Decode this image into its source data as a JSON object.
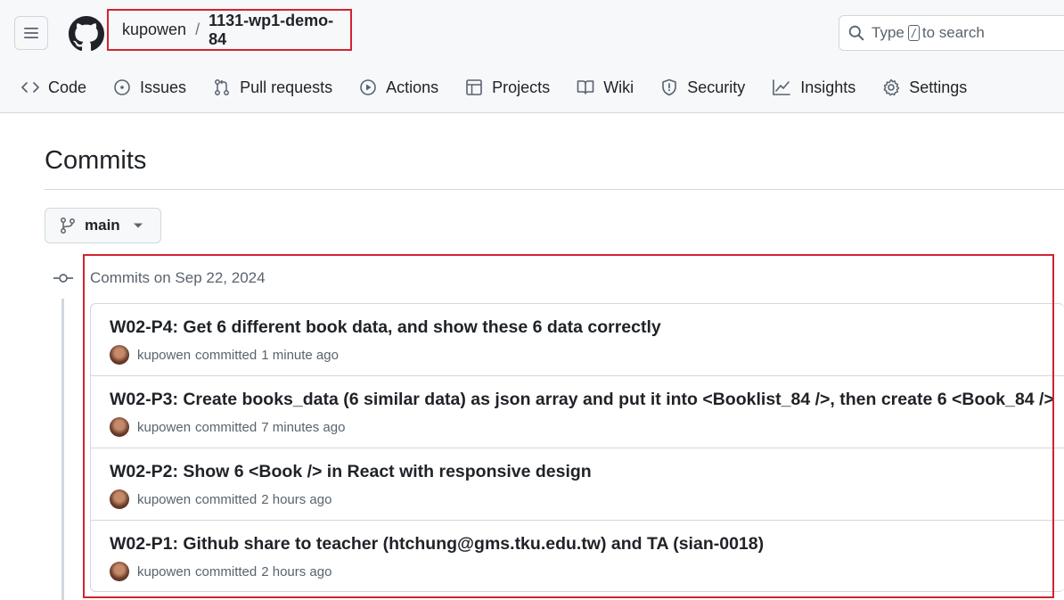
{
  "header": {
    "repo_owner": "kupowen",
    "repo_separator": "/",
    "repo_name": "1131-wp1-demo-84",
    "search_prefix": "Type",
    "search_key": "/",
    "search_suffix": "to search"
  },
  "nav": [
    {
      "label": "Code",
      "icon": "code-icon"
    },
    {
      "label": "Issues",
      "icon": "issue-icon"
    },
    {
      "label": "Pull requests",
      "icon": "pull-request-icon"
    },
    {
      "label": "Actions",
      "icon": "play-icon"
    },
    {
      "label": "Projects",
      "icon": "table-icon"
    },
    {
      "label": "Wiki",
      "icon": "book-icon"
    },
    {
      "label": "Security",
      "icon": "shield-icon"
    },
    {
      "label": "Insights",
      "icon": "graph-icon"
    },
    {
      "label": "Settings",
      "icon": "gear-icon"
    }
  ],
  "page": {
    "title": "Commits",
    "branch": "main",
    "group_label": "Commits on Sep 22, 2024"
  },
  "commits": [
    {
      "message": "W02-P4: Get 6 different book data, and show these 6 data correctly",
      "author": "kupowen",
      "action": "committed",
      "time": "1 minute ago"
    },
    {
      "message": "W02-P3: Create books_data (6 similar data) as json array and put it into <Booklist_84 />, then create 6 <Book_84 />",
      "author": "kupowen",
      "action": "committed",
      "time": "7 minutes ago"
    },
    {
      "message": "W02-P2: Show 6 <Book /> in React with responsive design",
      "author": "kupowen",
      "action": "committed",
      "time": "2 hours ago"
    },
    {
      "message": "W02-P1: Github share to teacher (htchung@gms.tku.edu.tw) and TA (sian-0018)",
      "author": "kupowen",
      "action": "committed",
      "time": "2 hours ago"
    }
  ],
  "colors": {
    "highlight": "#d1242f",
    "border": "#d0d7de",
    "muted": "#59636e"
  }
}
